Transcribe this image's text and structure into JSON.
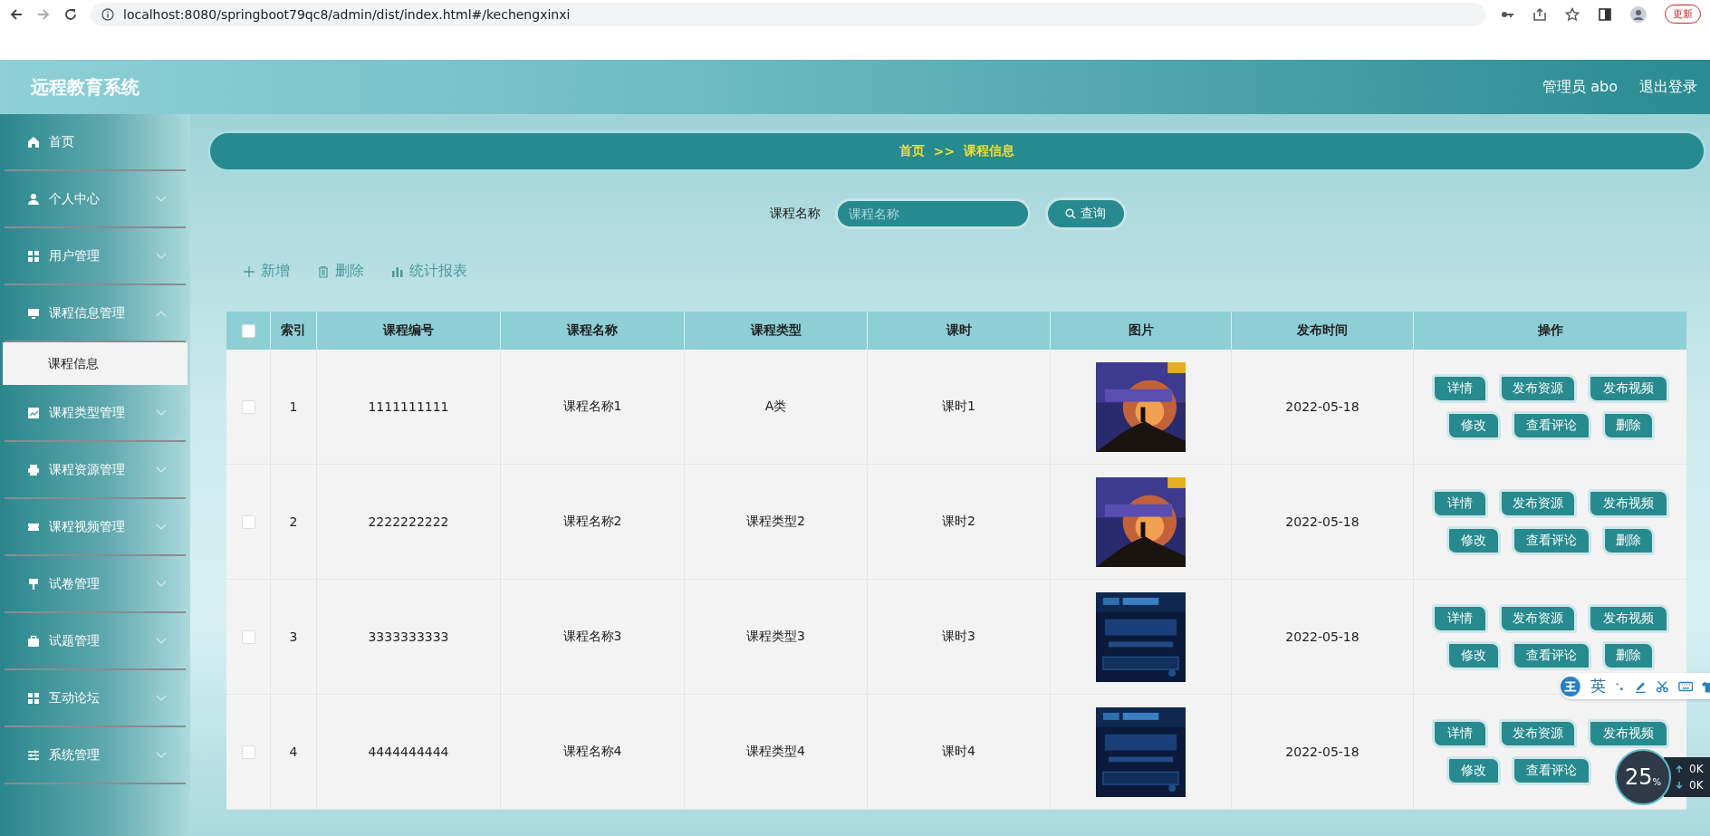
{
  "browser": {
    "url": "localhost:8080/springboot79qc8/admin/dist/index.html#/kechengxinxi",
    "update_button": "更新"
  },
  "header": {
    "title": "远程教育系统",
    "user": "管理员 abo",
    "logout": "退出登录"
  },
  "sidebar": {
    "items": [
      {
        "label": "首页",
        "kind": "link"
      },
      {
        "label": "个人中心",
        "kind": "menu",
        "expanded": false
      },
      {
        "label": "用户管理",
        "kind": "menu",
        "expanded": false
      },
      {
        "label": "课程信息管理",
        "kind": "menu",
        "expanded": true,
        "children": [
          {
            "label": "课程信息",
            "selected": true
          }
        ]
      },
      {
        "label": "课程类型管理",
        "kind": "menu",
        "expanded": false
      },
      {
        "label": "课程资源管理",
        "kind": "menu",
        "expanded": false
      },
      {
        "label": "课程视频管理",
        "kind": "menu",
        "expanded": false
      },
      {
        "label": "试卷管理",
        "kind": "menu",
        "expanded": false
      },
      {
        "label": "试题管理",
        "kind": "menu",
        "expanded": false
      },
      {
        "label": "互动论坛",
        "kind": "menu",
        "expanded": false
      },
      {
        "label": "系统管理",
        "kind": "menu",
        "expanded": false
      }
    ]
  },
  "breadcrumb": [
    "首页",
    ">>",
    "课程信息"
  ],
  "search": {
    "label": "课程名称",
    "placeholder": "课程名称",
    "button": "查询"
  },
  "toolbar": [
    {
      "label": "新增",
      "kind": "add"
    },
    {
      "label": "删除",
      "kind": "delete"
    },
    {
      "label": "统计报表",
      "kind": "report"
    }
  ],
  "table": {
    "select_all": {
      "checked": false
    },
    "columns": [
      "索引",
      "课程编号",
      "课程名称",
      "课程类型",
      "课时",
      "图片",
      "发布时间",
      "操作"
    ],
    "rows": [
      {
        "checked": false,
        "cells": [
          "1",
          "1111111111",
          "课程名称1",
          "A类",
          "课时1"
        ],
        "image": {
          "kind": "picture"
        },
        "date": "2022-05-18",
        "actions": [
          [
            "详情",
            "发布资源",
            "发布视频"
          ],
          [
            "修改",
            "查看评论",
            "删除"
          ]
        ]
      },
      {
        "checked": false,
        "cells": [
          "2",
          "2222222222",
          "课程名称2",
          "课程类型2",
          "课时2"
        ],
        "image": {
          "kind": "picture"
        },
        "date": "2022-05-18",
        "actions": [
          [
            "详情",
            "发布资源",
            "发布视频"
          ],
          [
            "修改",
            "查看评论",
            "删除"
          ]
        ]
      },
      {
        "checked": false,
        "cells": [
          "3",
          "3333333333",
          "课程名称3",
          "课程类型3",
          "课时3"
        ],
        "image": {
          "kind": "picture"
        },
        "date": "2022-05-18",
        "actions": [
          [
            "详情",
            "发布资源",
            "发布视频"
          ],
          [
            "修改",
            "查看评论",
            "删除"
          ]
        ]
      },
      {
        "checked": false,
        "cells": [
          "4",
          "4444444444",
          "课程名称4",
          "课程类型4",
          "课时4"
        ],
        "image": {
          "kind": "picture"
        },
        "date": "2022-05-18",
        "actions": [
          [
            "详情",
            "发布资源",
            "发布视频"
          ],
          [
            "修改",
            "查看评论"
          ]
        ]
      }
    ]
  },
  "ime_bar": {
    "mode": "英"
  },
  "speed_widget": {
    "percent": "25",
    "unit": "%",
    "upload": "0K",
    "download": "0K"
  }
}
